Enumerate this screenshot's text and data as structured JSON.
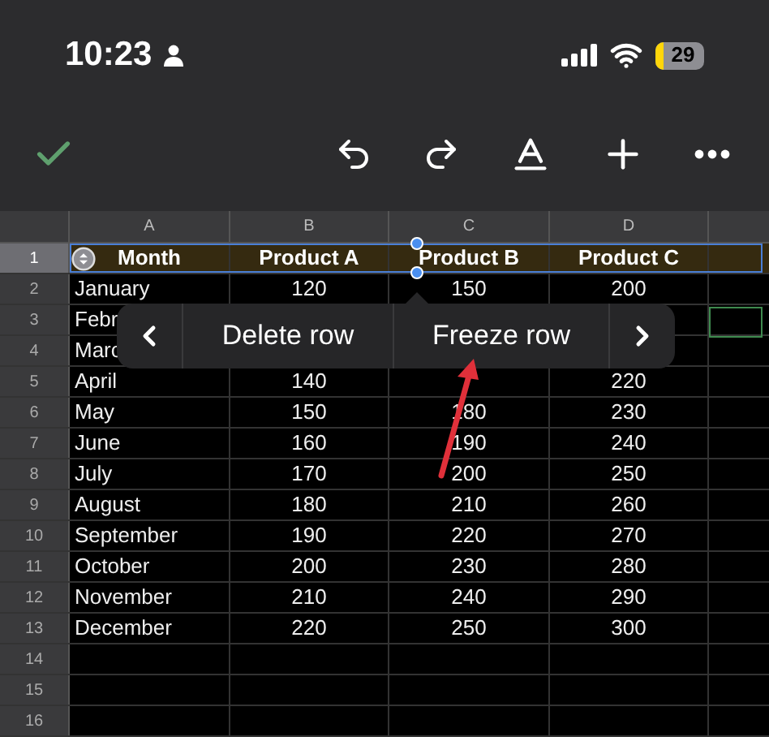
{
  "status_bar": {
    "time": "10:23",
    "battery": "29"
  },
  "sheet": {
    "columns": [
      "A",
      "B",
      "C",
      "D"
    ],
    "rows": [
      {
        "number": "1",
        "kind": "header",
        "selected": true,
        "cells": [
          "Month",
          "Product A",
          "Product B",
          "Product C"
        ]
      },
      {
        "number": "2",
        "kind": "data",
        "selected": false,
        "cells": [
          "January",
          "120",
          "150",
          "200"
        ]
      },
      {
        "number": "3",
        "kind": "data",
        "selected": false,
        "cells": [
          "Febr",
          null,
          null,
          null
        ]
      },
      {
        "number": "4",
        "kind": "data",
        "selected": false,
        "cells": [
          "Marc",
          null,
          null,
          null
        ]
      },
      {
        "number": "5",
        "kind": "data",
        "selected": false,
        "cells": [
          "April",
          "140",
          null,
          "220"
        ]
      },
      {
        "number": "6",
        "kind": "data",
        "selected": false,
        "cells": [
          "May",
          "150",
          "180",
          "230"
        ]
      },
      {
        "number": "7",
        "kind": "data",
        "selected": false,
        "cells": [
          "June",
          "160",
          "190",
          "240"
        ]
      },
      {
        "number": "8",
        "kind": "data",
        "selected": false,
        "cells": [
          "July",
          "170",
          "200",
          "250"
        ]
      },
      {
        "number": "9",
        "kind": "data",
        "selected": false,
        "cells": [
          "August",
          "180",
          "210",
          "260"
        ]
      },
      {
        "number": "10",
        "kind": "data",
        "selected": false,
        "cells": [
          "September",
          "190",
          "220",
          "270"
        ]
      },
      {
        "number": "11",
        "kind": "data",
        "selected": false,
        "cells": [
          "October",
          "200",
          "230",
          "280"
        ]
      },
      {
        "number": "12",
        "kind": "data",
        "selected": false,
        "cells": [
          "November",
          "210",
          "240",
          "290"
        ]
      },
      {
        "number": "13",
        "kind": "data",
        "selected": false,
        "cells": [
          "December",
          "220",
          "250",
          "300"
        ]
      },
      {
        "number": "14",
        "kind": "data",
        "selected": false,
        "cells": []
      },
      {
        "number": "15",
        "kind": "data",
        "selected": false,
        "cells": []
      },
      {
        "number": "16",
        "kind": "data",
        "selected": false,
        "cells": []
      }
    ]
  },
  "context_menu": {
    "items": [
      "Delete row",
      "Freeze row"
    ]
  }
}
